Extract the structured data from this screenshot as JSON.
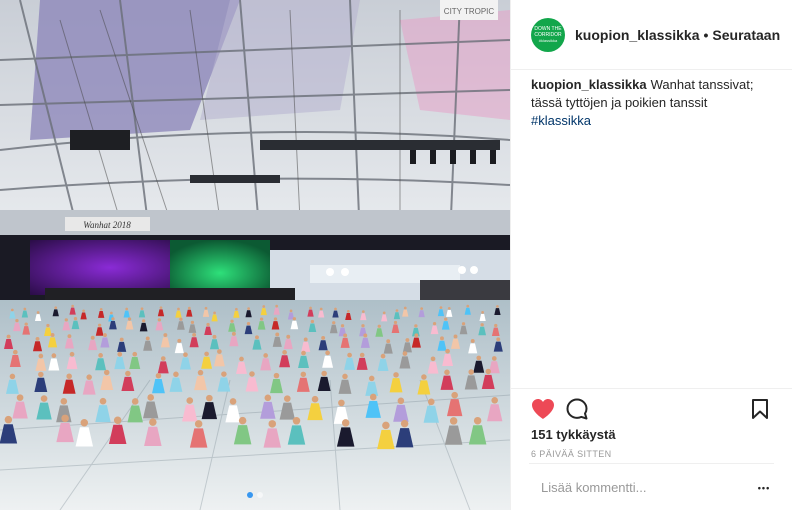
{
  "post": {
    "username": "kuopion_klassikka",
    "separator": "•",
    "follow_label": "Seurataan",
    "avatar": {
      "line1": "DOWN THE",
      "line2": "CORRIDOR",
      "line3": "#klassikka",
      "color": "#12a64b"
    },
    "caption": {
      "username": "kuopion_klassikka",
      "text": "Wanhat tanssivat; tässä tyttöjen ja poikien tanssit",
      "hashtag": "#klassikka"
    },
    "likes": "151 tykkäystä",
    "timestamp": "6 PÄIVÄÄ SITTEN",
    "comment_placeholder": "Lisää kommentti...",
    "more_label": "•••",
    "icons": {
      "like": "heart-icon",
      "comment": "comment-icon",
      "save": "bookmark-icon",
      "more": "more-icon"
    },
    "colors": {
      "heart": "#ed4956",
      "link": "#003569",
      "carousel_active": "#3897f0"
    }
  },
  "photo": {
    "banner_text": "Wanhat 2018",
    "sign_text": "CITY TROPIC",
    "description_colors": {
      "stage_purple": "#5a1c8c",
      "stage_green": "#1cc266"
    }
  },
  "carousel": {
    "total": 2,
    "active": 1
  }
}
